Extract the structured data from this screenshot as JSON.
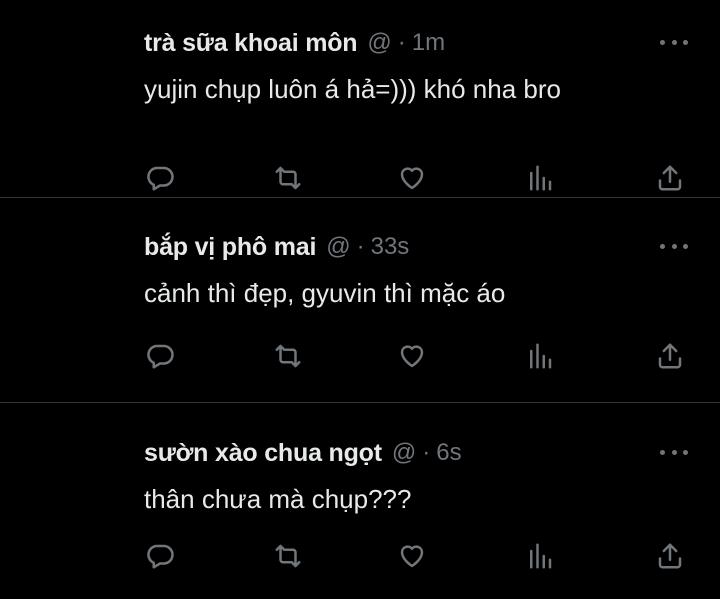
{
  "tweets": [
    {
      "name": "trà sữa khoai môn",
      "handle": "@",
      "separator": "·",
      "time": "1m",
      "text": "yujin chụp luôn á hả=))) khó nha bro"
    },
    {
      "name": "bắp vị phô mai",
      "handle": "@",
      "separator": "·",
      "time": "33s",
      "text": "cảnh thì đẹp, gyuvin thì mặc áo"
    },
    {
      "name": "sườn xào chua ngọt",
      "handle": "@",
      "separator": "·",
      "time": "6s",
      "text": "thân chưa mà chụp???"
    }
  ],
  "icons": {
    "reply": "reply-icon",
    "retweet": "retweet-icon",
    "like": "heart-icon",
    "views": "analytics-icon",
    "share": "share-icon",
    "more": "more-icon"
  },
  "colors": {
    "background": "#000000",
    "text_primary": "#e7e9ea",
    "text_secondary": "#71767b",
    "divider": "#2f3336"
  }
}
